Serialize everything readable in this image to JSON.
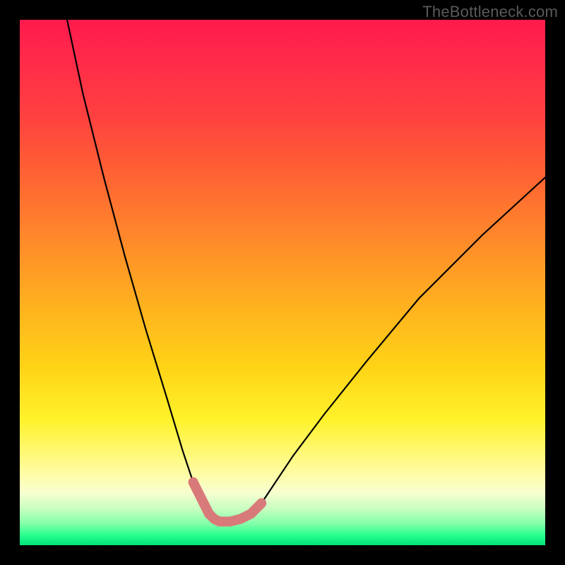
{
  "watermark": "TheBottleneck.com",
  "chart_data": {
    "type": "line",
    "title": "",
    "xlabel": "",
    "ylabel": "",
    "xlim": [
      0,
      100
    ],
    "ylim": [
      0,
      100
    ],
    "grid": false,
    "series": [
      {
        "name": "bottleneck-curve",
        "color": "#000000",
        "x": [
          9,
          12,
          16,
          20,
          24,
          28,
          31,
          33,
          35,
          36,
          37,
          38,
          40,
          42,
          44,
          45,
          46,
          48,
          52,
          58,
          66,
          76,
          88,
          100
        ],
        "values": [
          100,
          86,
          70,
          55,
          41,
          28,
          18,
          12,
          8,
          6,
          5,
          4.5,
          4.5,
          5,
          6,
          7,
          8,
          11,
          17,
          25,
          35,
          47,
          59,
          70
        ]
      },
      {
        "name": "highlight-bottom",
        "color": "#d97a7a",
        "x": [
          33,
          35,
          36,
          37,
          38,
          40,
          42,
          44,
          45,
          46
        ],
        "values": [
          12,
          8,
          6,
          5,
          4.5,
          4.5,
          5,
          6,
          7,
          8
        ]
      }
    ],
    "background_gradient": {
      "top": "#ff1a4d",
      "upper_mid": "#ff8a2a",
      "mid": "#ffd316",
      "lower_mid": "#fffca0",
      "bottom": "#00e47a"
    }
  }
}
